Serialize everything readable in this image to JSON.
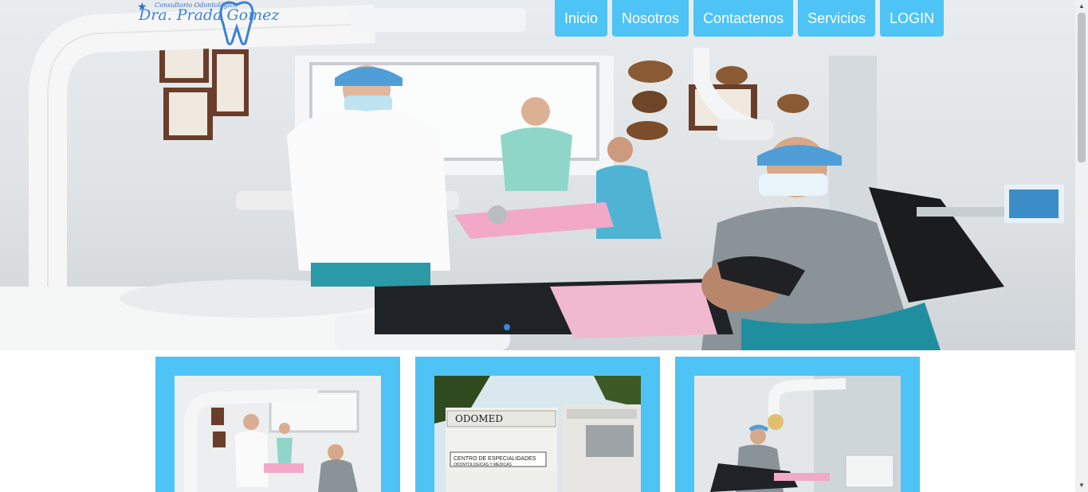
{
  "logo": {
    "tagline": "Consultorio Odontológico",
    "name": "Dra. Prada Gomez"
  },
  "nav": {
    "items": [
      "Inicio",
      "Nosotros",
      "Contactenos",
      "Servicios",
      "LOGIN"
    ]
  },
  "hero": {
    "carousel_active_index": 0,
    "indicator_color": "#3a86d8"
  },
  "cards": [
    {
      "photo_sign": ""
    },
    {
      "photo_sign": "ODOMED",
      "photo_sign2": "CENTRO DE ESPECIALIDADES",
      "photo_sign3": "ODONTOLOGICAS Y MEDICAS"
    },
    {
      "photo_sign": ""
    }
  ],
  "colors": {
    "accent": "#4ec3f5",
    "nav_text": "#ffffff",
    "logo_blue": "#3b82d6"
  }
}
